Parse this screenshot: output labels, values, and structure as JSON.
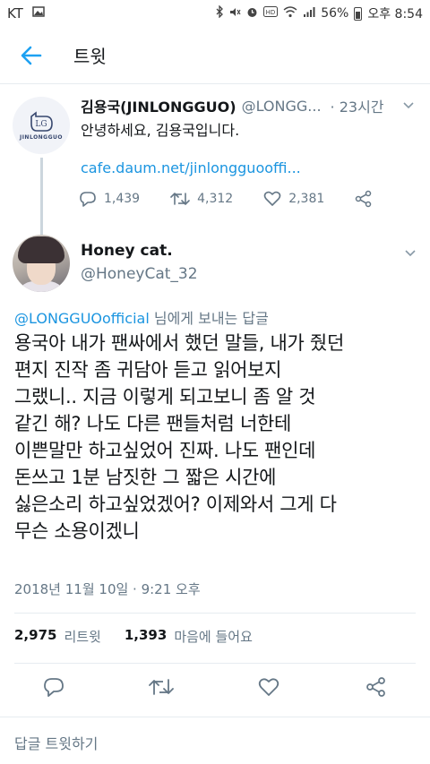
{
  "status_bar": {
    "carrier": "KT",
    "battery": "56%",
    "time": "오후 8:54",
    "icons": [
      "gallery-icon",
      "bluetooth-icon",
      "mute-icon",
      "alarm-icon",
      "hd-icon",
      "wifi-icon",
      "signal-icon",
      "battery-icon"
    ]
  },
  "header": {
    "title": "트윗",
    "back_icon": "arrow-left-icon",
    "accent": "#1da1f2"
  },
  "parent_tweet": {
    "avatar_logo_text": "JINLONGGUO",
    "name": "김용국(JINLONGGUO)",
    "handle": "@LONGG...",
    "time": "· 23시간",
    "text": "안녕하세요, 김용국입니다.",
    "link": "cafe.daum.net/jinlongguooffi...",
    "replies": "1,439",
    "retweets": "4,312",
    "likes": "2,381"
  },
  "tweet": {
    "name": "Honey cat.",
    "handle": "@HoneyCat_32",
    "reply_mention": "@LONGGUOofficial",
    "reply_suffix": " 님에게 보내는 답글",
    "text": "용국아 내가 팬싸에서 했던 말들, 내가 줬던\n편지 진작 좀 귀담아 듣고 읽어보지\n그랬니.. 지금 이렇게 되고보니 좀 알 것\n같긴 해? 나도 다른 팬들처럼 너한테\n이쁜말만 하고싶었어 진짜. 나도 팬인데\n돈쓰고 1분 남짓한 그 짧은 시간에\n싫은소리 하고싶었겠어? 이제와서 그게 다\n무슨 소용이겠니",
    "timestamp": "2018년 11월 10일 · 9:21 오후",
    "retweet_count": "2,975",
    "retweet_label": "리트윗",
    "like_count": "1,393",
    "like_label": "마음에 들어요"
  },
  "reply_box": {
    "placeholder": "답글 트윗하기"
  },
  "colors": {
    "link": "#1b95e0",
    "secondary_text": "#657786",
    "border": "#e6ecf0"
  }
}
